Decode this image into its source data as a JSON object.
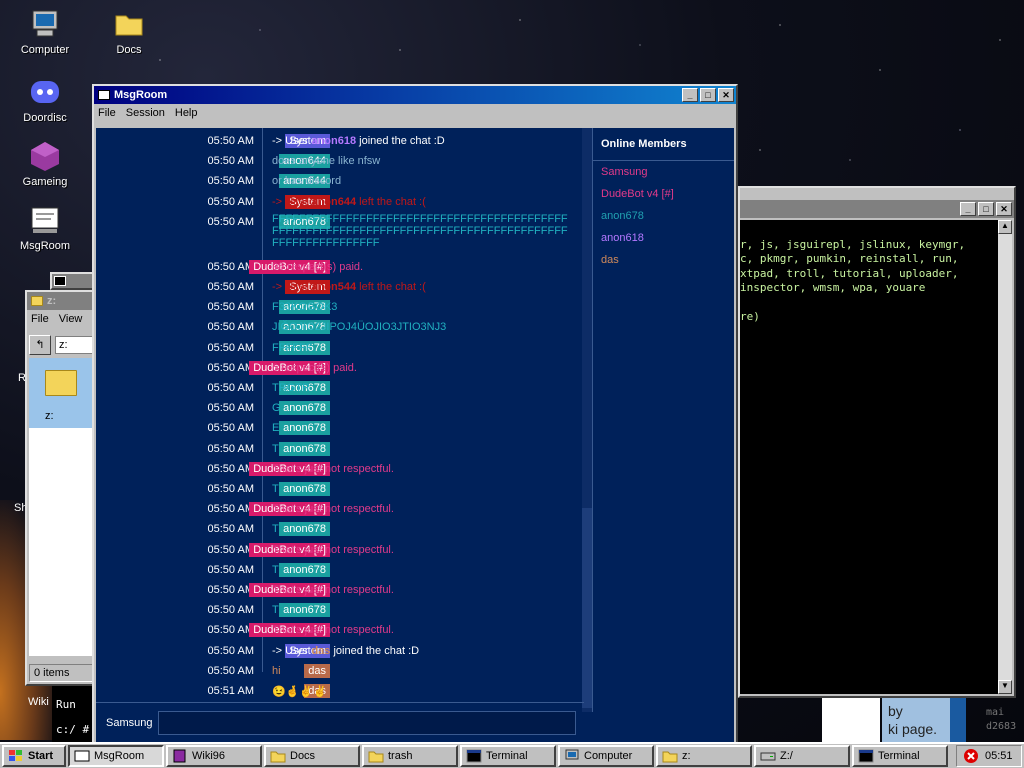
{
  "desktop": {
    "icons": [
      {
        "label": "Computer",
        "icon": "computer-icon"
      },
      {
        "label": "Docs",
        "icon": "folder-icon"
      },
      {
        "label": "Doordisc",
        "icon": "discord-icon"
      },
      {
        "label": "Gameing",
        "icon": "cube-icon"
      },
      {
        "label": "MsgRoom",
        "icon": "msgroom-icon"
      }
    ]
  },
  "msgroom": {
    "title": "MsgRoom",
    "menu": [
      "File",
      "Session",
      "Help"
    ],
    "messages": [
      {
        "time": "05:50 AM",
        "user": "System",
        "user_color": "#5a5ad8",
        "text": "-> User ",
        "emph": "anon618",
        "emph_color": "#b478ff",
        "rest": " joined the chat :D",
        "text_color": "#ffffff"
      },
      {
        "time": "05:50 AM",
        "user": "anon644",
        "user_color": "#1aa0a0",
        "text": "does anyone like nfsw",
        "text_color": "#8ab4d0"
      },
      {
        "time": "05:50 AM",
        "user": "anon644",
        "user_color": "#1aa0a0",
        "text": "or has discord",
        "text_color": "#8ab4d0"
      },
      {
        "time": "05:50 AM",
        "user": "System",
        "user_color": "#c01818",
        "text": "-> User ",
        "emph": "anon644",
        "emph_color": "#c01818",
        "rest": " left the chat :(",
        "text_color": "#c01818"
      },
      {
        "time": "05:50 AM",
        "user": "anon678",
        "user_color": "#1aa0a0",
        "text": "FFFFFFFFFFFFFFFFFFFFFFFFFFFFFFFFFFFFFFFFFFFFFFFFFFFFFFFFFFFFFFFFFFFFFFFFFFFFFFFFFFFFFFFFFFFFFFFFFFFFFFFF",
        "text_color": "#20b0c0"
      },
      {
        "time": "05:50 AM",
        "user": "DudeBot v4 [#]",
        "user_color": "#d81a6a",
        "text": "96 respect(s) paid.",
        "text_color": "#e23a8a"
      },
      {
        "time": "05:50 AM",
        "user": "System",
        "user_color": "#c01818",
        "text": "-> User ",
        "emph": "anon544",
        "emph_color": "#c01818",
        "rest": " left the chat :(",
        "text_color": "#c01818"
      },
      {
        "time": "05:50 AM",
        "user": "anon678",
        "user_color": "#1aa0a0",
        "text": "F33KOGOK3",
        "text_color": "#20b0c0"
      },
      {
        "time": "05:50 AM",
        "user": "anon678",
        "user_color": "#1aa0a0",
        "text": "JIĞOJIO2JIPOJ4ÜOJIO3JTIO3NJ3",
        "text_color": "#20b0c0"
      },
      {
        "time": "05:50 AM",
        "user": "anon678",
        "user_color": "#1aa0a0",
        "text": "FFFFFF",
        "text_color": "#20b0c0"
      },
      {
        "time": "05:50 AM",
        "user": "DudeBot v4 [#]",
        "user_color": "#d81a6a",
        "text": "6 respect(s) paid.",
        "text_color": "#e23a8a"
      },
      {
        "time": "05:50 AM",
        "user": "anon678",
        "user_color": "#1aa0a0",
        "text": "TRGTR",
        "text_color": "#20b0c0"
      },
      {
        "time": "05:50 AM",
        "user": "anon678",
        "user_color": "#1aa0a0",
        "text": "G",
        "text_color": "#20b0c0"
      },
      {
        "time": "05:50 AM",
        "user": "anon678",
        "user_color": "#1aa0a0",
        "text": "E",
        "text_color": "#20b0c0"
      },
      {
        "time": "05:50 AM",
        "user": "anon678",
        "user_color": "#1aa0a0",
        "text": "T",
        "text_color": "#20b0c0"
      },
      {
        "time": "05:50 AM",
        "user": "DudeBot v4 [#]",
        "user_color": "#d81a6a",
        "text": "That's just not respectful.",
        "text_color": "#e23a8a"
      },
      {
        "time": "05:50 AM",
        "user": "anon678",
        "user_color": "#1aa0a0",
        "text": "T",
        "text_color": "#20b0c0"
      },
      {
        "time": "05:50 AM",
        "user": "DudeBot v4 [#]",
        "user_color": "#d81a6a",
        "text": "That's just not respectful.",
        "text_color": "#e23a8a"
      },
      {
        "time": "05:50 AM",
        "user": "anon678",
        "user_color": "#1aa0a0",
        "text": "T",
        "text_color": "#20b0c0"
      },
      {
        "time": "05:50 AM",
        "user": "DudeBot v4 [#]",
        "user_color": "#d81a6a",
        "text": "That's just not respectful.",
        "text_color": "#e23a8a"
      },
      {
        "time": "05:50 AM",
        "user": "anon678",
        "user_color": "#1aa0a0",
        "text": "T",
        "text_color": "#20b0c0"
      },
      {
        "time": "05:50 AM",
        "user": "DudeBot v4 [#]",
        "user_color": "#d81a6a",
        "text": "That's just not respectful.",
        "text_color": "#e23a8a"
      },
      {
        "time": "05:50 AM",
        "user": "anon678",
        "user_color": "#1aa0a0",
        "text": "T",
        "text_color": "#20b0c0"
      },
      {
        "time": "05:50 AM",
        "user": "DudeBot v4 [#]",
        "user_color": "#d81a6a",
        "text": "That's just not respectful.",
        "text_color": "#e23a8a"
      },
      {
        "time": "05:50 AM",
        "user": "System",
        "user_color": "#5a5ad8",
        "text": "-> User ",
        "emph": "das",
        "emph_color": "#d08a5a",
        "rest": " joined the chat :D",
        "text_color": "#ffffff"
      },
      {
        "time": "05:50 AM",
        "user": "das",
        "user_color": "#b86a4a",
        "text": "hi",
        "text_color": "#d08a5a"
      },
      {
        "time": "05:51 AM",
        "user": "das",
        "user_color": "#b86a4a",
        "text": "😉🤞✌✌",
        "text_color": "#f0c020"
      }
    ],
    "members_title": "Online Members",
    "members": [
      {
        "name": "Samsung",
        "color": "#e23a8a"
      },
      {
        "name": "DudeBot v4 [#]",
        "color": "#e23a8a"
      },
      {
        "name": "anon678",
        "color": "#20a0b0"
      },
      {
        "name": "anon618",
        "color": "#b478ff"
      },
      {
        "name": "das",
        "color": "#d08a5a"
      }
    ],
    "input_nick": "Samsung"
  },
  "explorer": {
    "title": "z:",
    "menu": [
      "File",
      "View"
    ],
    "address": "z:",
    "folder_label": "z:",
    "status": "0 items"
  },
  "terminal": {
    "lines": [
      "r, js, jsguirepl, jslinux, keymgr,",
      "c, pkmgr, pumkin, reinstall, run,",
      "xtpad, troll, tutorial, uploader,",
      "inspector, wmsm, wpa, youare",
      "",
      "re)"
    ]
  },
  "taskbar": {
    "start": "Start",
    "items": [
      {
        "label": "MsgRoom",
        "icon": "msgroom-icon",
        "active": true
      },
      {
        "label": "Wiki96",
        "icon": "book-icon",
        "active": false
      },
      {
        "label": "Docs",
        "icon": "folder-icon",
        "active": false
      },
      {
        "label": "trash",
        "icon": "folder-icon",
        "active": false
      },
      {
        "label": "Terminal",
        "icon": "terminal-icon",
        "active": false
      },
      {
        "label": "Computer",
        "icon": "computer-icon",
        "active": false
      },
      {
        "label": "z:",
        "icon": "folder-icon",
        "active": false
      },
      {
        "label": "Z:/",
        "icon": "drive-icon",
        "active": false
      },
      {
        "label": "Terminal",
        "icon": "terminal-icon",
        "active": false
      }
    ],
    "clock": "05:51"
  },
  "background_text": {
    "run": "Run",
    "prompt": "c:/ #",
    "wiki_by": "by",
    "wiki_page": "ki page.",
    "side_r": "R",
    "side_sh": "Sh",
    "side_wiki": "Wiki",
    "corner_main": "mai",
    "corner_hash": "d2683"
  }
}
